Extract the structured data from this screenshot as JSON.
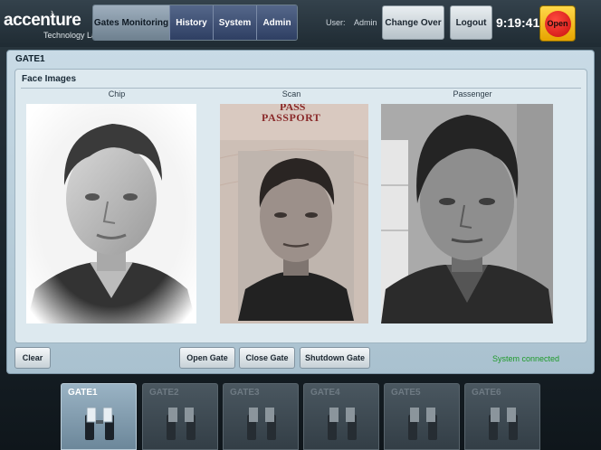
{
  "header": {
    "logo": {
      "brand": "accenture",
      "sub": "Technology Labs"
    },
    "nav": [
      {
        "label": "Gates Monitoring",
        "active": true
      },
      {
        "label": "History",
        "active": false
      },
      {
        "label": "System",
        "active": false
      },
      {
        "label": "Admin",
        "active": false
      }
    ],
    "user_label": "User:",
    "user_value": "Admin",
    "change_over_label": "Change Over",
    "logout_label": "Logout",
    "time": "9:19:41",
    "open_label": "Open"
  },
  "gate": {
    "title": "GATE1",
    "face_images": {
      "title": "Face Images",
      "labels": {
        "chip": "Chip",
        "scan": "Scan",
        "passenger": "Passenger"
      },
      "passport_text": "PASSPORT",
      "passport_top": "PASS"
    },
    "buttons": {
      "clear": "Clear",
      "open_gate": "Open Gate",
      "close_gate": "Close Gate",
      "shutdown_gate": "Shutdown Gate"
    },
    "status": "System connected"
  },
  "gate_tabs": [
    {
      "label": "GATE1",
      "active": true
    },
    {
      "label": "GATE2",
      "active": false
    },
    {
      "label": "GATE3",
      "active": false
    },
    {
      "label": "GATE4",
      "active": false
    },
    {
      "label": "GATE5",
      "active": false
    },
    {
      "label": "GATE6",
      "active": false
    }
  ],
  "colors": {
    "accent": "#3d4f78",
    "status_ok": "#1e9a2a",
    "open_indicator": "#e01a14"
  }
}
